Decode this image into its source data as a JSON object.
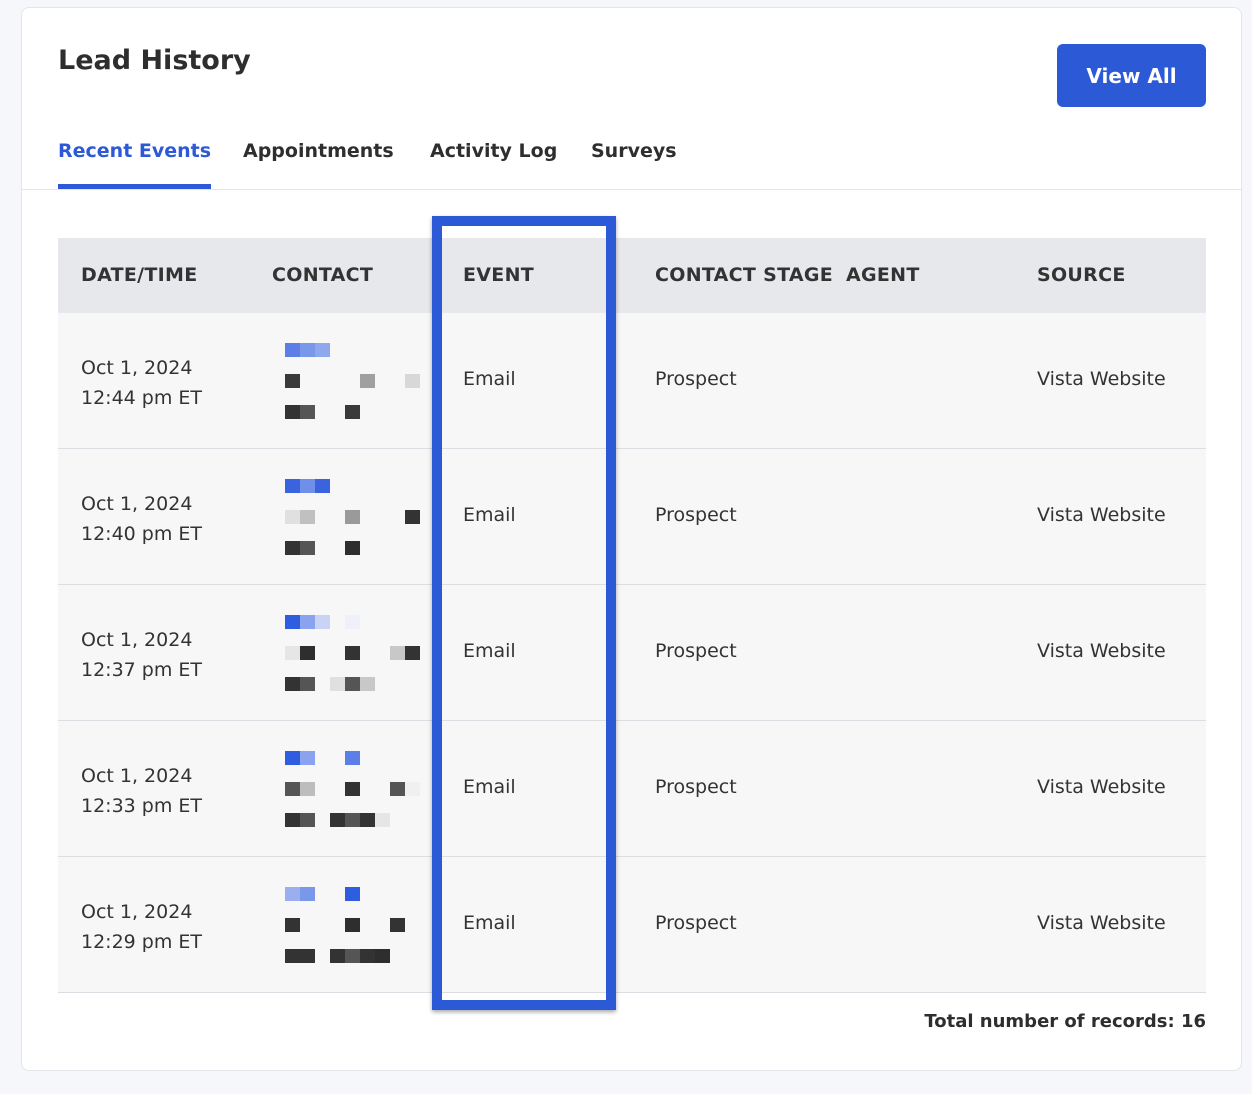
{
  "card": {
    "title": "Lead History",
    "view_all_label": "View All"
  },
  "tabs": [
    {
      "label": "Recent Events",
      "active": true
    },
    {
      "label": "Appointments",
      "active": false
    },
    {
      "label": "Activity Log",
      "active": false
    },
    {
      "label": "Surveys",
      "active": false
    }
  ],
  "table": {
    "headers": [
      "DATE/TIME",
      "CONTACT",
      "EVENT",
      "CONTACT STAGE",
      "AGENT",
      "SOURCE"
    ],
    "rows": [
      {
        "date": "Oct 1, 2024",
        "time": "12:44 pm ET",
        "event": "Email",
        "stage": "Prospect",
        "agent": "",
        "source": "Vista Website"
      },
      {
        "date": "Oct 1, 2024",
        "time": "12:40 pm ET",
        "event": "Email",
        "stage": "Prospect",
        "agent": "",
        "source": "Vista Website"
      },
      {
        "date": "Oct 1, 2024",
        "time": "12:37 pm ET",
        "event": "Email",
        "stage": "Prospect",
        "agent": "",
        "source": "Vista Website"
      },
      {
        "date": "Oct 1, 2024",
        "time": "12:33 pm ET",
        "event": "Email",
        "stage": "Prospect",
        "agent": "",
        "source": "Vista Website"
      },
      {
        "date": "Oct 1, 2024",
        "time": "12:29 pm ET",
        "event": "Email",
        "stage": "Prospect",
        "agent": "",
        "source": "Vista Website"
      }
    ]
  },
  "footer": {
    "total_label": "Total number of records: 16"
  },
  "colors": {
    "accent": "#2c59d6",
    "highlight_box": "#2c59d6",
    "header_bg": "#e7e8ec",
    "row_bg": "#f7f7f8"
  }
}
